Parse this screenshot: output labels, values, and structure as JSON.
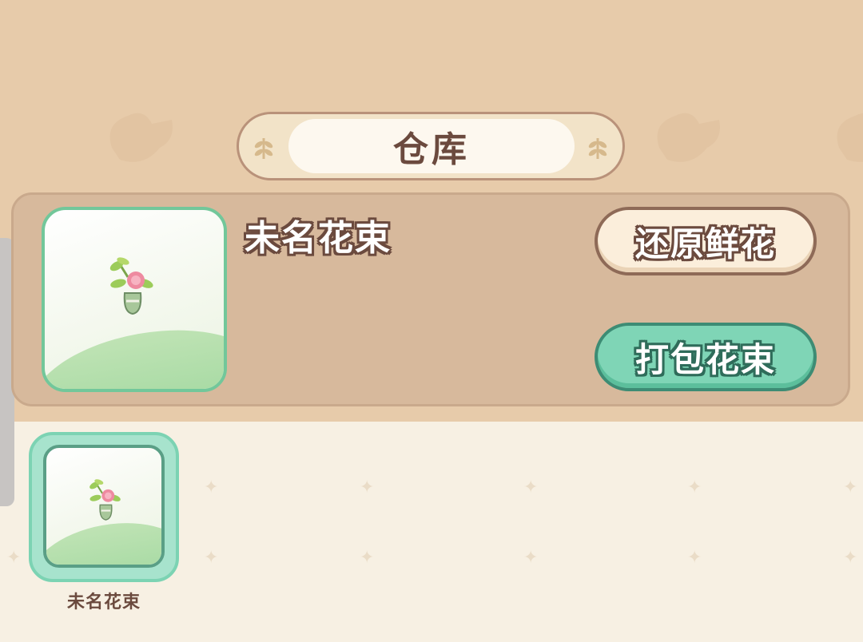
{
  "header": {
    "title": "仓库"
  },
  "detail": {
    "item_name": "未名花束",
    "item_icon": "flower-vase-icon",
    "restore_button": "还原鲜花",
    "pack_button": "打包花束"
  },
  "inventory": {
    "items": [
      {
        "label": "未名花束",
        "icon": "flower-vase-icon",
        "selected": true
      }
    ]
  },
  "colors": {
    "accent_green": "#7fd5b6",
    "text_brown": "#6b4a3e",
    "panel_tan": "#d7b99c",
    "background_top": "#e7cbaa",
    "background_bottom": "#f7f0e3"
  }
}
